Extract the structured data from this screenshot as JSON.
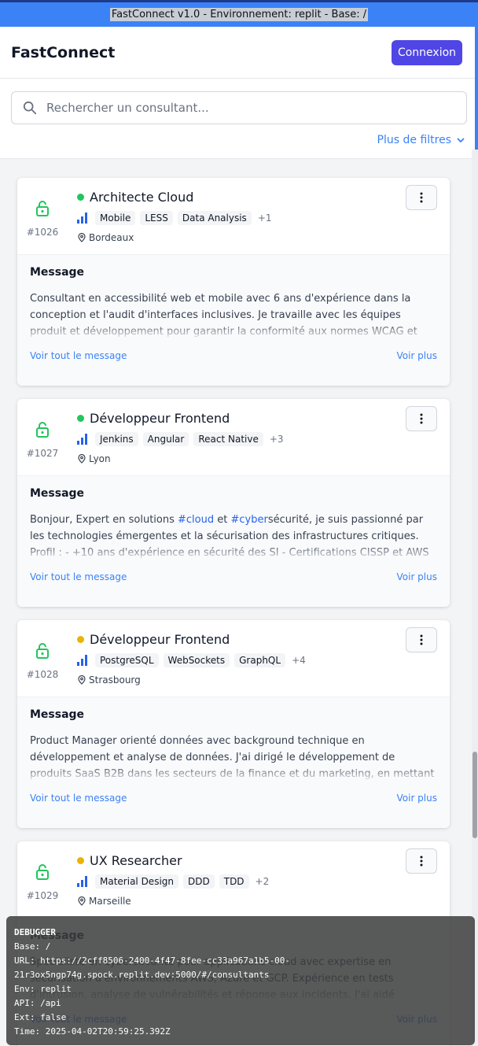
{
  "banner": {
    "text": "FastConnect v1.0 - Environnement: replit - Base: /"
  },
  "header": {
    "brand": "FastConnect",
    "login_label": "Connexion"
  },
  "search": {
    "placeholder": "Rechercher un consultant...",
    "filters_label": "Plus de filtres"
  },
  "colors": {
    "accent": "#4f46e5",
    "link": "#3b82f6",
    "status_green": "#22c55e",
    "status_yellow": "#eab308",
    "lock_green": "#22c55e"
  },
  "cards": [
    {
      "id": "#1026",
      "title": "Architecte Cloud",
      "status": "green",
      "skills": [
        "Mobile",
        "LESS",
        "Data Analysis"
      ],
      "more": "+1",
      "location": "Bordeaux",
      "message_label": "Message",
      "message": "Consultant en accessibilité web et mobile avec 6 ans d'expérience dans la conception et l'audit d'interfaces inclusives. Je travaille avec les équipes produit et développement pour garantir la conformité aux normes WCAG et l'inclusion de",
      "view_all": "Voir tout le message",
      "see_more": "Voir plus"
    },
    {
      "id": "#1027",
      "title": "Développeur Frontend",
      "status": "green",
      "skills": [
        "Jenkins",
        "Angular",
        "React Native"
      ],
      "more": "+3",
      "location": "Lyon",
      "message_label": "Message",
      "message_parts": [
        "Bonjour, Expert en solutions ",
        "#cloud",
        " et ",
        "#cyber",
        "sécurité, je suis passionné par les technologies émergentes et la sécurisation des infrastructures critiques. Profil : - +10 ans d'expérience en sécurité des SI - Certifications CISSP et AWS Security"
      ],
      "view_all": "Voir tout le message",
      "see_more": "Voir plus"
    },
    {
      "id": "#1028",
      "title": "Développeur Frontend",
      "status": "yellow",
      "skills": [
        "PostgreSQL",
        "WebSockets",
        "GraphQL"
      ],
      "more": "+4",
      "location": "Strasbourg",
      "message_label": "Message",
      "message": "Product Manager orienté données avec background technique en développement et analyse de données. J'ai dirigé le développement de produits SaaS B2B dans les secteurs de la finance et du marketing, en mettant l'accent sur l'expérience",
      "view_all": "Voir tout le message",
      "see_more": "Voir plus"
    },
    {
      "id": "#1029",
      "title": "UX Researcher",
      "status": "yellow",
      "skills": [
        "Material Design",
        "DDD",
        "TDD"
      ],
      "more": "+2",
      "location": "Marseille",
      "message_label": "Message",
      "message": "Spécialiste en cybersécurité pour applications cloud avec expertise en sécurisation d'environnements AWS, Azure et GCP. Expérience en tests d'intrusion, analyse de vulnérabilités et réponse aux incidents. J'ai aidé plusieurs entreprises à obtenir des",
      "view_all": "Voir tout le message",
      "see_more": "Voir plus"
    }
  ],
  "debugger": {
    "title": "DEBUGGER",
    "base": "Base: /",
    "url_line1": "URL: https://2cff8506-2400-4f47-8fee-cc33a967a1b5-00-",
    "url_line2": "21r3ox5ngp74g.spock.replit.dev:5000/#/consultants",
    "env": "Env: replit",
    "api": "API: /api",
    "ext": "Ext: false",
    "time": "Time: 2025-04-02T20:59:25.392Z"
  }
}
